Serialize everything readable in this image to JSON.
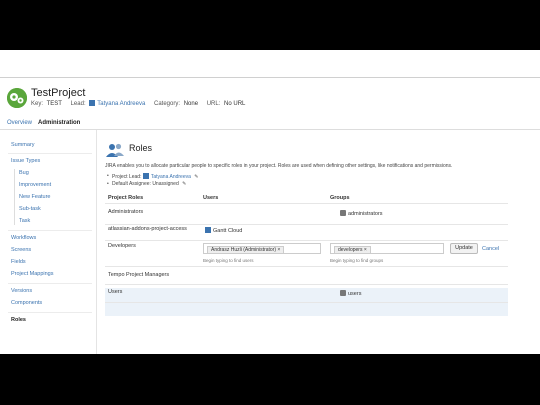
{
  "project": {
    "name": "TestProject",
    "key_label": "Key:",
    "key": "TEST",
    "lead_label": "Lead:",
    "lead": "Tatyana Andreeva",
    "category_label": "Category:",
    "category": "None",
    "url_label": "URL:",
    "url": "No URL"
  },
  "tabs": {
    "overview": "Overview",
    "administration": "Administration"
  },
  "sidebar": {
    "items": [
      {
        "label": "Summary"
      },
      {
        "label": "Issue Types"
      },
      {
        "label": "Bug"
      },
      {
        "label": "Improvement"
      },
      {
        "label": "New Feature"
      },
      {
        "label": "Sub-task"
      },
      {
        "label": "Task"
      },
      {
        "label": "Workflows"
      },
      {
        "label": "Screens"
      },
      {
        "label": "Fields"
      },
      {
        "label": "Project Mappings"
      },
      {
        "label": "Versions"
      },
      {
        "label": "Components"
      },
      {
        "label": "Roles"
      }
    ]
  },
  "roles": {
    "title": "Roles",
    "intro": "JIRA enables you to allocate particular people to specific roles in your project. Roles are used when defining other settings, like notifications and permissions.",
    "project_lead_label": "Project Lead:",
    "project_lead": "Tatyana Andreeva",
    "default_assignee_label": "Default Assignee:",
    "default_assignee": "Unassigned",
    "columns": [
      "Project Roles",
      "Users",
      "Groups"
    ],
    "rows": [
      {
        "role": "Administrators",
        "users": "",
        "groups": "administrators"
      },
      {
        "role": "atlassian-addons-project-access",
        "users": "Gantt Cloud",
        "groups": ""
      },
      {
        "role": "Developers",
        "users": "Andrasz Huzli (Administrator)",
        "groups": "developers"
      },
      {
        "role": "Tempo Project Managers",
        "users": "",
        "groups": ""
      },
      {
        "role": "Users",
        "users": "",
        "groups": "users"
      }
    ],
    "users_hint": "Begin typing to find users",
    "groups_hint": "Begin typing to find groups",
    "update_button": "Update",
    "cancel_link": "Cancel"
  },
  "colors": {
    "link": "#3b73af",
    "logo": "#5aa63b",
    "edit_row": "#ebf2f9"
  }
}
